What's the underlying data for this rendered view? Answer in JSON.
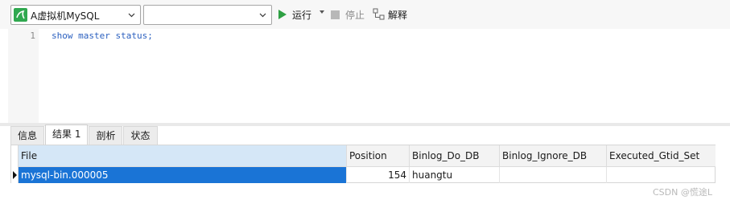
{
  "toolbar": {
    "connection": {
      "label": "A虚拟机MySQL",
      "icon": "mysql-connection-icon"
    },
    "database": {
      "value": ""
    },
    "run_label": "运行",
    "stop_label": "停止",
    "explain_label": "解释"
  },
  "editor": {
    "lines": [
      {
        "number": "1",
        "code": "show master status;"
      }
    ]
  },
  "result_tabs": [
    {
      "label": "信息"
    },
    {
      "label": "结果 1"
    },
    {
      "label": "剖析"
    },
    {
      "label": "状态"
    }
  ],
  "active_tab": "结果 1",
  "result_grid": {
    "columns": [
      "File",
      "Position",
      "Binlog_Do_DB",
      "Binlog_Ignore_DB",
      "Executed_Gtid_Set"
    ],
    "rows": [
      [
        "mysql-bin.000005",
        "154",
        "huangtu",
        "",
        ""
      ]
    ]
  },
  "watermark": "CSDN @慌途L",
  "colors": {
    "run_green": "#2ea043",
    "selection_blue": "#1a74d6",
    "header_selected": "#d5e7f7",
    "keyword_blue": "#2a5fbf"
  }
}
